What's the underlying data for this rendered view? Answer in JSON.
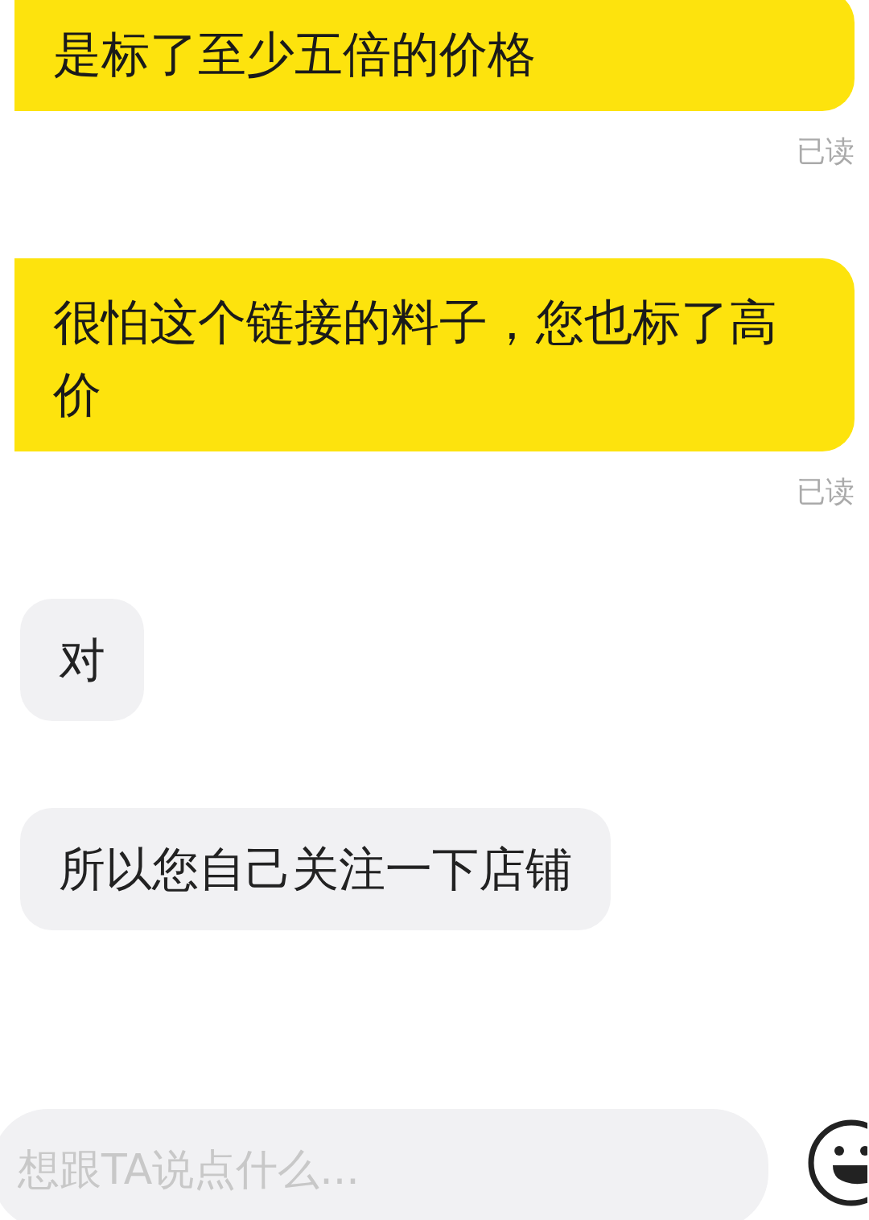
{
  "messages": [
    {
      "kind": "sent",
      "text": "是标了至少五倍的价格",
      "status": "已读"
    },
    {
      "kind": "sent",
      "text": "很怕这个链接的料子，您也标了高价",
      "status": "已读"
    },
    {
      "kind": "received",
      "text": "对"
    },
    {
      "kind": "received",
      "text": "所以您自己关注一下店铺"
    }
  ],
  "composer": {
    "placeholder": "想跟TA说点什么..."
  }
}
